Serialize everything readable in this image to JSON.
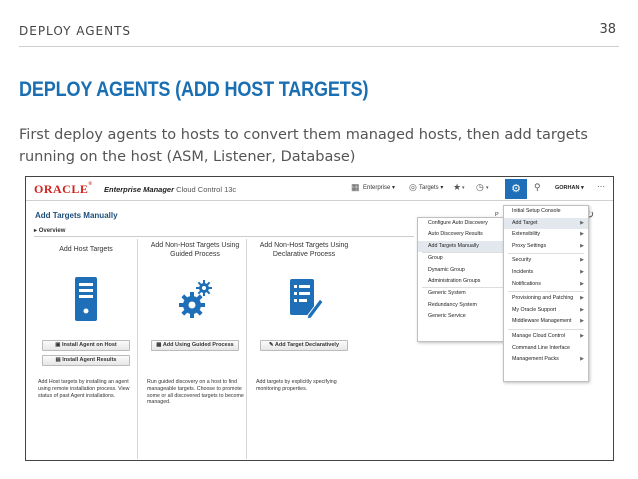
{
  "slide": {
    "header": "DEPLOY AGENTS",
    "page_number": "38",
    "title": "DEPLOY AGENTS (ADD HOST TARGETS)",
    "body": "First deploy agents to hosts to convert them managed hosts, then add targets running on the host (ASM, Listener, Database)"
  },
  "app": {
    "logo": "ORACLE",
    "logo_reg": "®",
    "product": "Enterprise Manager",
    "edition": "Cloud Control 13c",
    "menus": {
      "enterprise": "Enterprise ▾",
      "targets": "Targets ▾"
    },
    "user": "GORHAN ▾",
    "page_title": "Add Targets Manually",
    "overview": "Overview",
    "partial_label": "P"
  },
  "cards": [
    {
      "title": "Add Host Targets",
      "buttons": [
        "Install Agent on Host",
        "Install Agent Results"
      ],
      "description": "Add Host targets by installing an agent using remote installation process. View status of past Agent installations."
    },
    {
      "title": "Add Non-Host Targets Using Guided Process",
      "buttons": [
        "Add Using Guided Process"
      ],
      "description": "Run guided discovery on a host to find manageable targets. Choose to promote some or all discovered targets to become managed."
    },
    {
      "title": "Add Non-Host Targets Using Declarative Process",
      "buttons": [
        "Add Target Declaratively"
      ],
      "description": "Add targets by explicitly specifying monitoring properties."
    }
  ],
  "submenu": [
    "Configure Auto Discovery",
    "Auto Discovery Results",
    "Add Targets Manually",
    "Group",
    "Dynamic Group",
    "Administration Groups",
    "Generic System",
    "Redundancy System",
    "Generic Service"
  ],
  "mainmenu": [
    "Initial Setup Console",
    "Add Target",
    "Extensibility",
    "Proxy Settings",
    "Security",
    "Incidents",
    "Notifications",
    "Provisioning and Patching",
    "My Oracle Support",
    "Middleware Management",
    "Manage Cloud Control",
    "Command Line Interface",
    "Management Packs"
  ],
  "colors": {
    "title_blue": "#1a6fb3",
    "oracle_red": "#d0231f",
    "icon_blue": "#1e6fb8"
  }
}
